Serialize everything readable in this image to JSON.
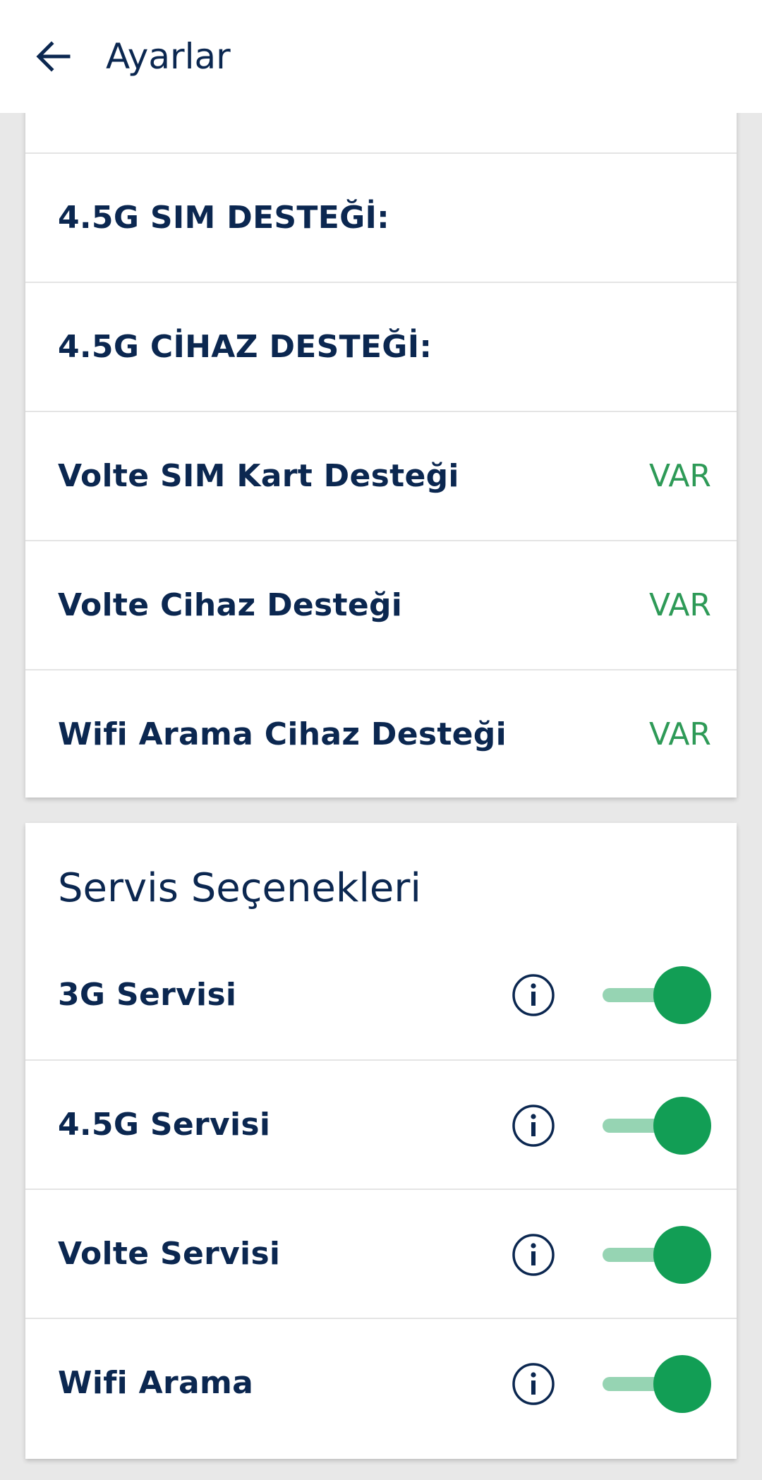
{
  "header": {
    "title": "Ayarlar",
    "back_icon": "arrow-left-icon"
  },
  "device_support": {
    "rows": [
      {
        "label": "4.5G SIM DESTEĞİ:",
        "value": ""
      },
      {
        "label": "4.5G CİHAZ DESTEĞİ:",
        "value": ""
      },
      {
        "label": "Volte SIM Kart Desteği",
        "value": "VAR"
      },
      {
        "label": "Volte Cihaz Desteği",
        "value": "VAR"
      },
      {
        "label": "Wifi Arama Cihaz Desteği",
        "value": "VAR"
      }
    ]
  },
  "services": {
    "title": "Servis Seçenekleri",
    "items": [
      {
        "label": "3G Servisi",
        "enabled": true
      },
      {
        "label": "4.5G Servisi",
        "enabled": true
      },
      {
        "label": "Volte Servisi",
        "enabled": true
      },
      {
        "label": "Wifi Arama",
        "enabled": true
      }
    ]
  },
  "colors": {
    "text": "#0b2750",
    "value_green": "#2e9a57",
    "toggle_knob": "#129e55",
    "toggle_track": "#96d4b3"
  }
}
